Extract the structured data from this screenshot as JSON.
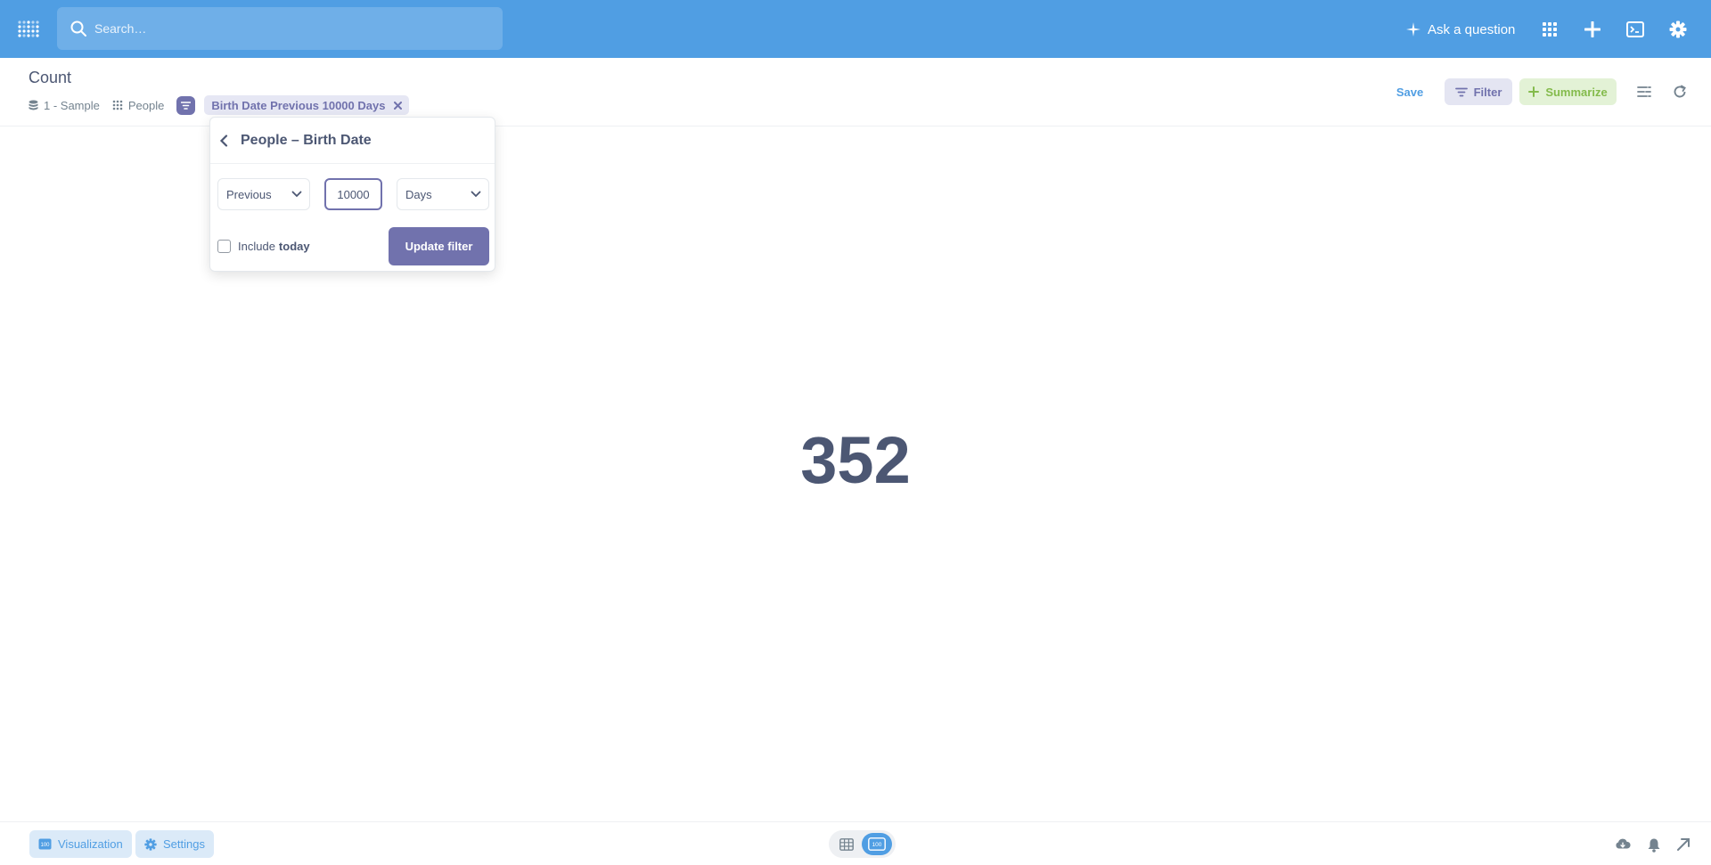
{
  "navbar": {
    "search_placeholder": "Search…",
    "ask_label": "Ask a question",
    "icons": [
      "metabase-logo-icon",
      "search-icon",
      "sparkle-icon",
      "grid-icon",
      "plus-icon",
      "terminal-icon",
      "gear-icon"
    ]
  },
  "query": {
    "title": "Count",
    "database": "1 - Sample",
    "table": "People",
    "filter_pill": "Birth Date Previous 10000 Days"
  },
  "header_actions": {
    "save": "Save",
    "filter": "Filter",
    "summarize": "Summarize"
  },
  "popover": {
    "title": "People – Birth Date",
    "direction": "Previous",
    "amount": "10000",
    "unit": "Days",
    "include_label": "Include",
    "include_bold": "today",
    "include_checked": false,
    "update_label": "Update filter"
  },
  "result": {
    "value": "352"
  },
  "footer": {
    "visualization": "Visualization",
    "settings": "Settings",
    "view_mode": "scalar"
  },
  "colors": {
    "brand": "#509ee3",
    "filter": "#7172ad",
    "summarize": "#84bb4c",
    "text": "#4c5773"
  }
}
